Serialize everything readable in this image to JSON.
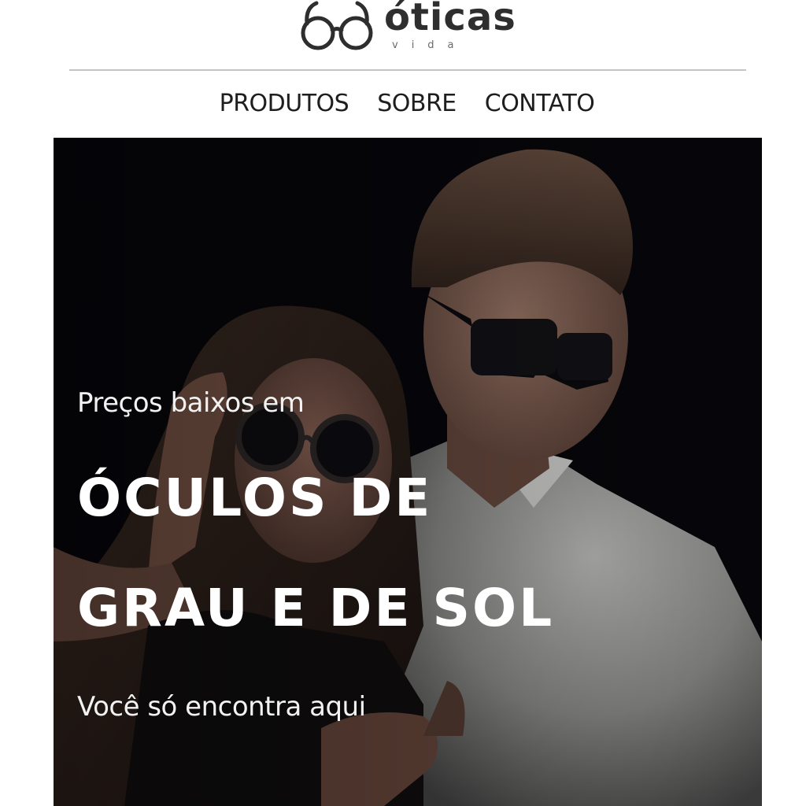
{
  "logo": {
    "brand": "óticas",
    "sub": "vida"
  },
  "nav": {
    "items": [
      {
        "label": "PRODUTOS"
      },
      {
        "label": "SOBRE"
      },
      {
        "label": "CONTATO"
      }
    ]
  },
  "hero": {
    "kicker": "Preços baixos em",
    "headline_line1": "ÓCULOS DE",
    "headline_line2": "GRAU E DE SOL",
    "tagline": "Você só encontra aqui"
  },
  "colors": {
    "logo": "#2e2e2e",
    "nav_text": "#1e1e1e",
    "hero_background": "#06060a",
    "hero_text": "#ffffff",
    "rule": "#c4c4c4"
  },
  "icons": {
    "logo_mark": "eyeglasses-icon"
  }
}
